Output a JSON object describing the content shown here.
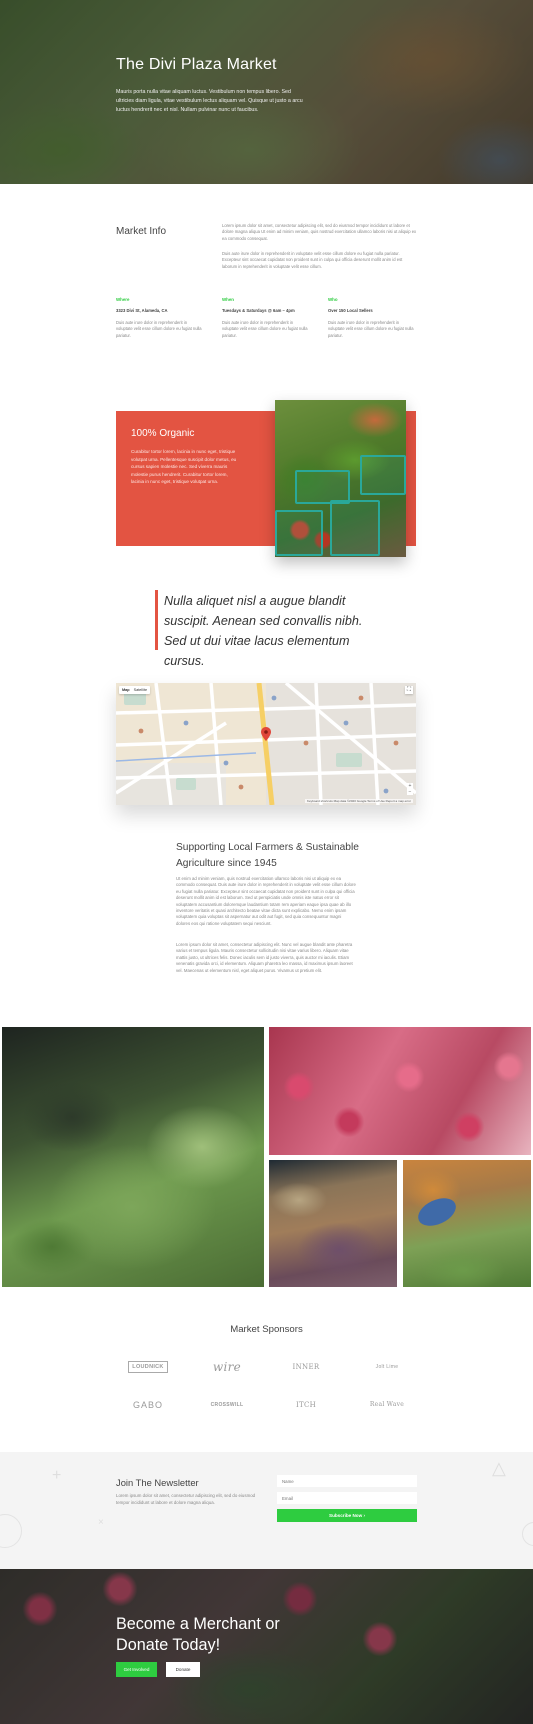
{
  "hero": {
    "title": "The Divi Plaza Market",
    "text": "Mauris porta nulla vitae aliquam luctus. Vestibulum non tempus libero. Sed ultricies diam ligula, vitae vestibulum lectus aliquam vel. Quisque ut justo a arcu luctus hendrerit nec et nisl. Nullam pulvinar nunc ut faucibus."
  },
  "market_info": {
    "title": "Market Info",
    "paragraphs": [
      "Lorem ipsum dolor sit amet, consectetur adipiscing elit, sed do eiusmod tempor incididunt ut labore et dolore magna aliqua Ut enim ad minim veniam, quis nostrud exercitation ullamco laboris nisi ut aliquip ex ea commodo consequat.",
      "Duis aute irure dolor in reprehenderit in voluptate velit esse cillum dolore eu fugiat nulla pariatur. Excepteur sint occaecat cupidatat non proident sunt in culpa qui officia deserunt mollit anim id est laborum in reprehenderit in voluptate velit esse cillum."
    ],
    "columns": [
      {
        "label": "Where",
        "value": "3323 Divi St, Alameda, CA",
        "desc": "Duis aute irure dolor in reprehenderit in voluptate velit esse cillum dolore eu fugiat nulla pariatur."
      },
      {
        "label": "When",
        "value": "Tuesdays & Saturdays @ 6am – 4pm",
        "desc": "Duis aute irure dolor in reprehenderit in voluptate velit esse cillum dolore eu fugiat nulla pariatur."
      },
      {
        "label": "Who",
        "value": "Over 150 Local Sellers",
        "desc": "Duis aute irure dolor in reprehenderit in voluptate velit esse cillum dolore eu fugiat nulla pariatur."
      }
    ]
  },
  "organic": {
    "title": "100% Organic",
    "text": "Curabitur tortor lorem, lacinia in nunc eget, tristique volutpat urna. Pellentesque suscipit dolor metus, eu cursus sapien molestie nec. Sed viverra mauris molestie purus hendrerit. Curabitur tortor lorem, lacinia in nunc eget, tristique volutpat urna."
  },
  "quote": {
    "text": "Nulla aliquet nisl a augue blandit suscipit. Aenean sed convallis nibh. Sed ut dui vitae lacus elementum cursus."
  },
  "map": {
    "tab_map": "Map",
    "tab_satellite": "Satellite",
    "footer": "Keyboard shortcuts  Map data ©2020 Google  Terms of Use  Report a map error"
  },
  "story": {
    "title": "Supporting Local Farmers & Sustainable Agriculture since 1945",
    "paragraphs": [
      "Ut enim ad minim veniam, quis nostrud exercitation ullamco laboris nisi ut aliquip ex ea commodo consequat. Duis aute irure dolor in reprehenderit in voluptate velit esse cillum dolore eu fugiat nulla pariatur. Excepteur sint occaecat cupidatat non proident sunt in culpa qui officia deserunt mollit anim id est laborum. Sed ut perspiciatis unde omnis iste natus error sit voluptatem accusantium doloremque laudantium totam rem aperiam eaque ipsa quae ab illo inventore veritatis et quasi architecto beatae vitae dicta sunt explicabo. Nemo enim ipsam voluptatem quia voluptas sit aspernatur aut odit aut fugit, sed quia consequuntur magni dolores eos qui ratione voluptatem sequi nesciunt.",
      "Lorem ipsum dolor sit amet, consectetur adipiscing elit. Nunc vel augue blandit ante pharetra varius et tempus ligula. Mauris consectetur sollicitudin nisi vitae varius libero. Aliquam vitae mattis justo, ut ultrices felis. Donec iaculis sem id justo viverra, quis auctor mi iaculis. Etiam venenatis gravida orci, id elementum. Aliquam pharetra leo massa, id maximus ipsum laoreet vel. Maecenas ut elementum nisl, eget aliquet purus. Vivamus ut pretium elit."
    ]
  },
  "sponsors": {
    "title": "Market Sponsors",
    "logos": [
      "LOUDNICK",
      "wire",
      "INNER",
      "Jolt Lime",
      "GABO",
      "CROSSWILL",
      "ITCH",
      "Real Wave"
    ]
  },
  "newsletter": {
    "title": "Join The Newsletter",
    "text": "Lorem ipsum dolor sit amet, consectetur adipiscing elit, sed do eiusmod tempor incididunt ut labore et dolore magna aliqua.",
    "name_placeholder": "Name",
    "email_placeholder": "Email",
    "button": "Subscribe Now  ›"
  },
  "cta": {
    "title": "Become a Merchant or Donate Today!",
    "primary_button": "Get Involved",
    "secondary_button": "Donate"
  },
  "colors": {
    "accent_green": "#2ecc40",
    "accent_red": "#e35442"
  }
}
